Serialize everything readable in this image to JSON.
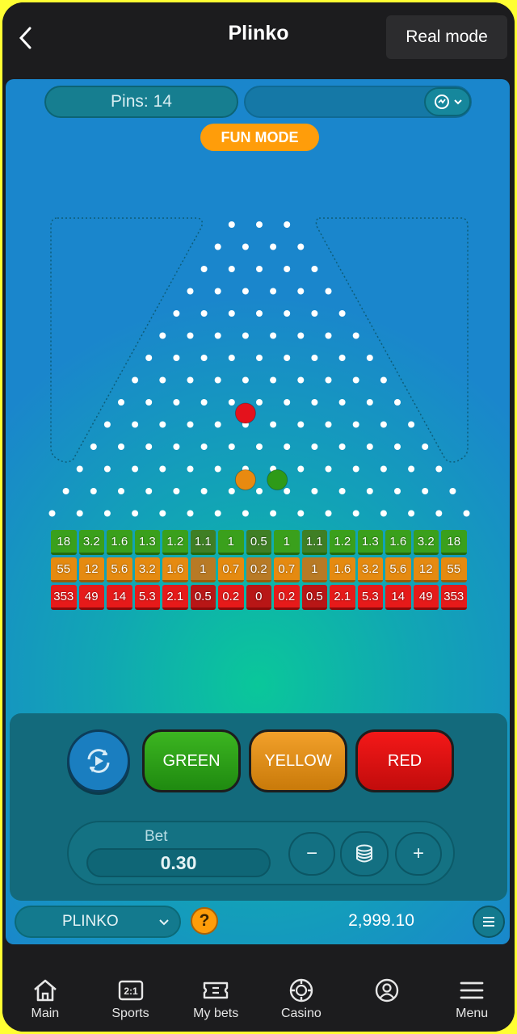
{
  "header": {
    "title": "Plinko",
    "real_mode_label": "Real mode"
  },
  "game": {
    "pins_label": "Pins: 14",
    "fun_mode_label": "FUN MODE",
    "pin_rows": 14,
    "balls": [
      {
        "color": "#e4121c",
        "row": 9,
        "slot": 10.0
      },
      {
        "color": "#e88a10",
        "row": 12,
        "slot": 13.0
      },
      {
        "color": "#2e9a18",
        "row": 12,
        "slot": 15.3
      }
    ],
    "multipliers": {
      "green": [
        "18",
        "3.2",
        "1.6",
        "1.3",
        "1.2",
        "1.1",
        "1",
        "0.5",
        "1",
        "1.1",
        "1.2",
        "1.3",
        "1.6",
        "3.2",
        "18"
      ],
      "yellow": [
        "55",
        "12",
        "5.6",
        "3.2",
        "1.6",
        "1",
        "0.7",
        "0.2",
        "0.7",
        "1",
        "1.6",
        "3.2",
        "5.6",
        "12",
        "55"
      ],
      "red": [
        "353",
        "49",
        "14",
        "5.3",
        "2.1",
        "0.5",
        "0.2",
        "0",
        "0.2",
        "0.5",
        "2.1",
        "5.3",
        "14",
        "49",
        "353"
      ]
    }
  },
  "controls": {
    "green_label": "GREEN",
    "yellow_label": "YELLOW",
    "red_label": "RED",
    "bet_label": "Bet",
    "bet_value": "0.30",
    "minus": "−",
    "plus": "+"
  },
  "footer": {
    "game_name": "PLINKO",
    "help": "?",
    "balance": "2,999.10"
  },
  "nav": [
    {
      "label": "Main",
      "icon": "home-icon"
    },
    {
      "label": "Sports",
      "icon": "sports-icon"
    },
    {
      "label": "My bets",
      "icon": "ticket-icon"
    },
    {
      "label": "Casino",
      "icon": "casino-chip-icon"
    },
    {
      "label": "",
      "icon": "profile-icon"
    },
    {
      "label": "Menu",
      "icon": "menu-icon"
    }
  ],
  "colors": {
    "green": "#3aa01c",
    "yellow": "#e58a10",
    "red": "#e61a1a",
    "fun_mode": "#ff9d0a"
  }
}
